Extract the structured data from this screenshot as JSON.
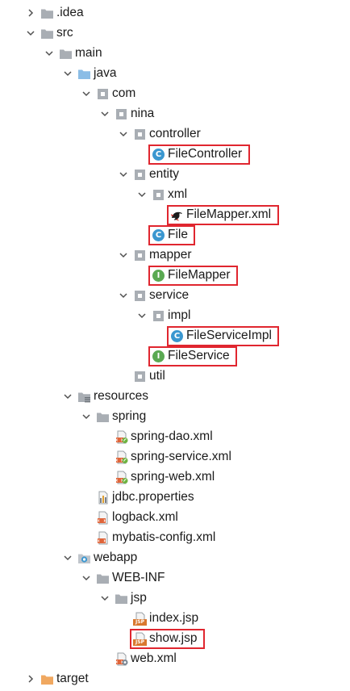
{
  "tree": [
    {
      "label": ".idea",
      "icon": "folder-icon",
      "depth": 0,
      "arrow": "collapsed"
    },
    {
      "label": "src",
      "icon": "folder-icon",
      "depth": 0,
      "arrow": "expanded"
    },
    {
      "label": "main",
      "icon": "folder-icon",
      "depth": 1,
      "arrow": "expanded"
    },
    {
      "label": "java",
      "icon": "source-folder-icon",
      "depth": 2,
      "arrow": "expanded"
    },
    {
      "label": "com",
      "icon": "package-icon",
      "depth": 3,
      "arrow": "expanded"
    },
    {
      "label": "nina",
      "icon": "package-icon",
      "depth": 4,
      "arrow": "expanded"
    },
    {
      "label": "controller",
      "icon": "package-icon",
      "depth": 5,
      "arrow": "expanded"
    },
    {
      "label": "FileController",
      "icon": "java-class-icon",
      "depth": 6,
      "arrow": "none",
      "highlighted": true
    },
    {
      "label": "entity",
      "icon": "package-icon",
      "depth": 5,
      "arrow": "expanded"
    },
    {
      "label": "xml",
      "icon": "package-icon",
      "depth": 6,
      "arrow": "expanded"
    },
    {
      "label": "FileMapper.xml",
      "icon": "mybatis-bird-icon",
      "depth": 7,
      "arrow": "none",
      "highlighted": true
    },
    {
      "label": "File",
      "icon": "java-class-icon",
      "depth": 6,
      "arrow": "none",
      "highlighted": true
    },
    {
      "label": "mapper",
      "icon": "package-icon",
      "depth": 5,
      "arrow": "expanded"
    },
    {
      "label": "FileMapper",
      "icon": "java-interface-icon",
      "depth": 6,
      "arrow": "none",
      "highlighted": true
    },
    {
      "label": "service",
      "icon": "package-icon",
      "depth": 5,
      "arrow": "expanded"
    },
    {
      "label": "impl",
      "icon": "package-icon",
      "depth": 6,
      "arrow": "expanded"
    },
    {
      "label": "FileServiceImpl",
      "icon": "java-class-icon",
      "depth": 7,
      "arrow": "none",
      "highlighted": true
    },
    {
      "label": "FileService",
      "icon": "java-interface-icon",
      "depth": 6,
      "arrow": "none",
      "highlighted": true
    },
    {
      "label": "util",
      "icon": "package-icon",
      "depth": 5,
      "arrow": "none"
    },
    {
      "label": "resources",
      "icon": "resources-folder-icon",
      "depth": 2,
      "arrow": "expanded"
    },
    {
      "label": "spring",
      "icon": "folder-icon",
      "depth": 3,
      "arrow": "expanded"
    },
    {
      "label": "spring-dao.xml",
      "icon": "spring-xml-icon",
      "depth": 4,
      "arrow": "none"
    },
    {
      "label": "spring-service.xml",
      "icon": "spring-xml-icon",
      "depth": 4,
      "arrow": "none"
    },
    {
      "label": "spring-web.xml",
      "icon": "spring-xml-icon",
      "depth": 4,
      "arrow": "none"
    },
    {
      "label": "jdbc.properties",
      "icon": "properties-file-icon",
      "depth": 3,
      "arrow": "none"
    },
    {
      "label": "logback.xml",
      "icon": "xml-file-icon",
      "depth": 3,
      "arrow": "none"
    },
    {
      "label": "mybatis-config.xml",
      "icon": "xml-file-icon",
      "depth": 3,
      "arrow": "none"
    },
    {
      "label": "webapp",
      "icon": "web-folder-icon",
      "depth": 2,
      "arrow": "expanded"
    },
    {
      "label": "WEB-INF",
      "icon": "folder-icon",
      "depth": 3,
      "arrow": "expanded"
    },
    {
      "label": "jsp",
      "icon": "folder-icon",
      "depth": 4,
      "arrow": "expanded"
    },
    {
      "label": "index.jsp",
      "icon": "jsp-file-icon",
      "depth": 5,
      "arrow": "none"
    },
    {
      "label": "show.jsp",
      "icon": "jsp-file-icon",
      "depth": 5,
      "arrow": "none",
      "highlighted": true
    },
    {
      "label": "web.xml",
      "icon": "web-xml-icon",
      "depth": 4,
      "arrow": "none"
    },
    {
      "label": "target",
      "icon": "excluded-folder-icon",
      "depth": 0,
      "arrow": "collapsed"
    }
  ],
  "colors": {
    "folder": "#a9aeb4",
    "source_folder": "#8bbde6",
    "resources_folder": "#a9aeb4",
    "excluded_folder": "#f0a860",
    "java_class": "#3a97d0",
    "java_interface": "#5aa952",
    "highlight_border": "#e0262f",
    "arrow": "#505050"
  }
}
